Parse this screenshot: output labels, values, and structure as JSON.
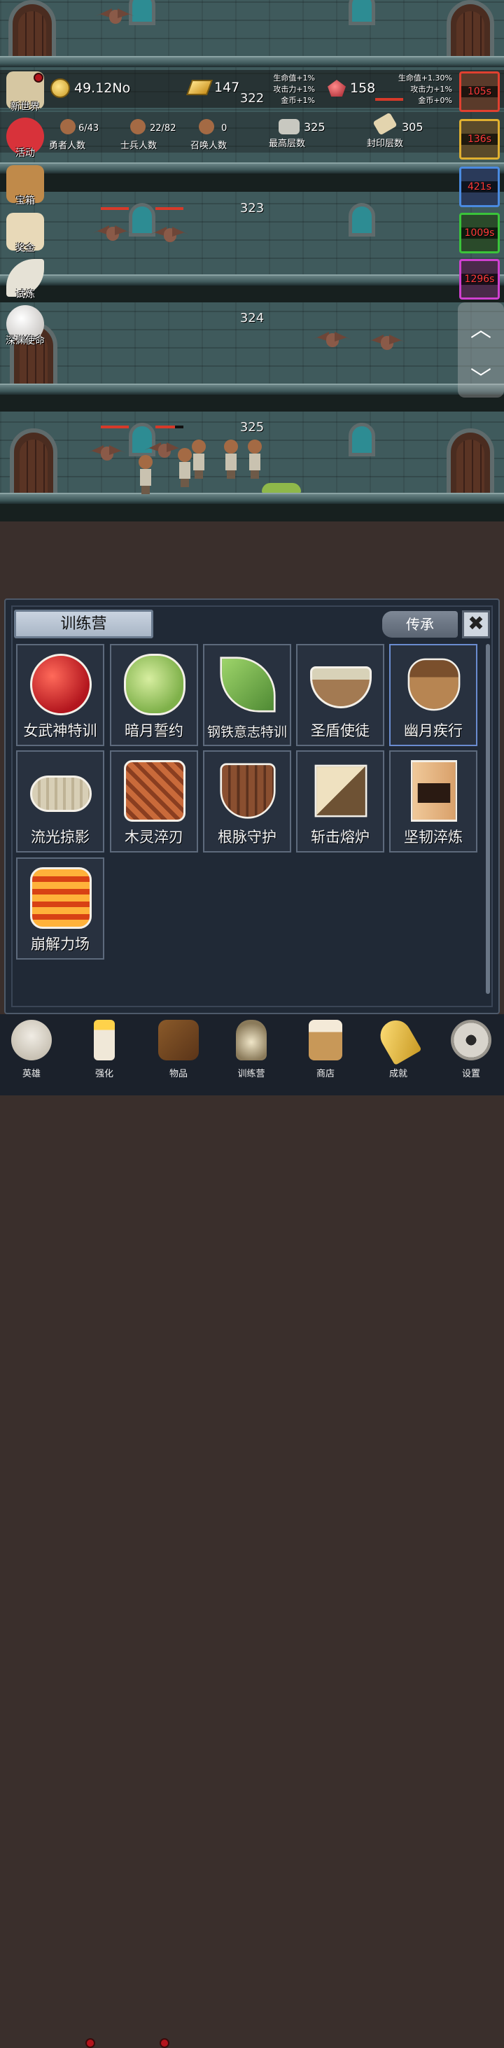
{
  "hud": {
    "gold": "49.12No",
    "gold_icon": "gold-coin-icon",
    "gold_bar": "147",
    "gems": "158",
    "floor_top": "322",
    "bonus_left": [
      "生命值+1%",
      "攻击力+1%",
      "金币+1%"
    ],
    "bonus_right": [
      "生命值+1.30%",
      "攻击力+1%",
      "金币+0%"
    ],
    "heroes_count": "6/43",
    "heroes_label": "勇者人数",
    "soldiers_count": "22/82",
    "soldiers_label": "士兵人数",
    "summons_count": "0",
    "summons_label": "召唤人数",
    "max_floor": "325",
    "max_floor_label": "最高层数",
    "seal_floor": "305",
    "seal_floor_label": "封印层数"
  },
  "left_menu": [
    {
      "label": "新世界",
      "icon": "map-icon",
      "color": "#d6c7a2"
    },
    {
      "label": "活动",
      "icon": "heart-icon",
      "color": "#d8323a"
    },
    {
      "label": "宝箱",
      "icon": "chest-icon",
      "color": "#c08a4a"
    },
    {
      "label": "奖金",
      "icon": "envelope-icon",
      "color": "#e8d9b8"
    },
    {
      "label": "试炼",
      "icon": "feather-icon",
      "color": "#e6e2d6"
    },
    {
      "label": "深渊使命",
      "icon": "orb-icon",
      "color": "#e4e2e0"
    }
  ],
  "floors": {
    "f323": "323",
    "f324": "324",
    "f325": "325"
  },
  "buffs": [
    {
      "timer": "105s",
      "color": "#e04030"
    },
    {
      "timer": "136s",
      "color": "#e0b030"
    },
    {
      "timer": "421s",
      "color": "#4a8ae0"
    },
    {
      "timer": "1009s",
      "color": "#3ac43a"
    },
    {
      "timer": "1296s",
      "color": "#d040d0"
    }
  ],
  "scroller": {
    "up": "︿",
    "down": "﹀"
  },
  "panel": {
    "title": "训练营",
    "legacy_label": "传承",
    "close_label": "✖"
  },
  "cards": [
    {
      "label": "女武神特训",
      "icon": "apple-icon"
    },
    {
      "label": "暗月誓约",
      "icon": "cabbage-icon"
    },
    {
      "label": "钢铁意志特训",
      "icon": "leaf-icon"
    },
    {
      "label": "圣盾使徒",
      "icon": "bowl-icon"
    },
    {
      "label": "幽月疾行",
      "icon": "acorn-icon"
    },
    {
      "label": "流光掠影",
      "icon": "fish-bone-icon"
    },
    {
      "label": "木灵淬刃",
      "icon": "log-icon"
    },
    {
      "label": "根脉守护",
      "icon": "wooden-shield-icon"
    },
    {
      "label": "斩击熔炉",
      "icon": "cube-icon"
    },
    {
      "label": "坚韧淬炼",
      "icon": "plank-icon"
    },
    {
      "label": "崩解力场",
      "icon": "lava-block-icon"
    }
  ],
  "nav": [
    {
      "label": "英雄",
      "icon": "skull-icon"
    },
    {
      "label": "强化",
      "icon": "candle-icon"
    },
    {
      "label": "物品",
      "icon": "book-icon"
    },
    {
      "label": "训练营",
      "icon": "lantern-icon"
    },
    {
      "label": "商店",
      "icon": "mug-icon"
    },
    {
      "label": "成就",
      "icon": "key-icon"
    },
    {
      "label": "设置",
      "icon": "gear-icon"
    }
  ]
}
